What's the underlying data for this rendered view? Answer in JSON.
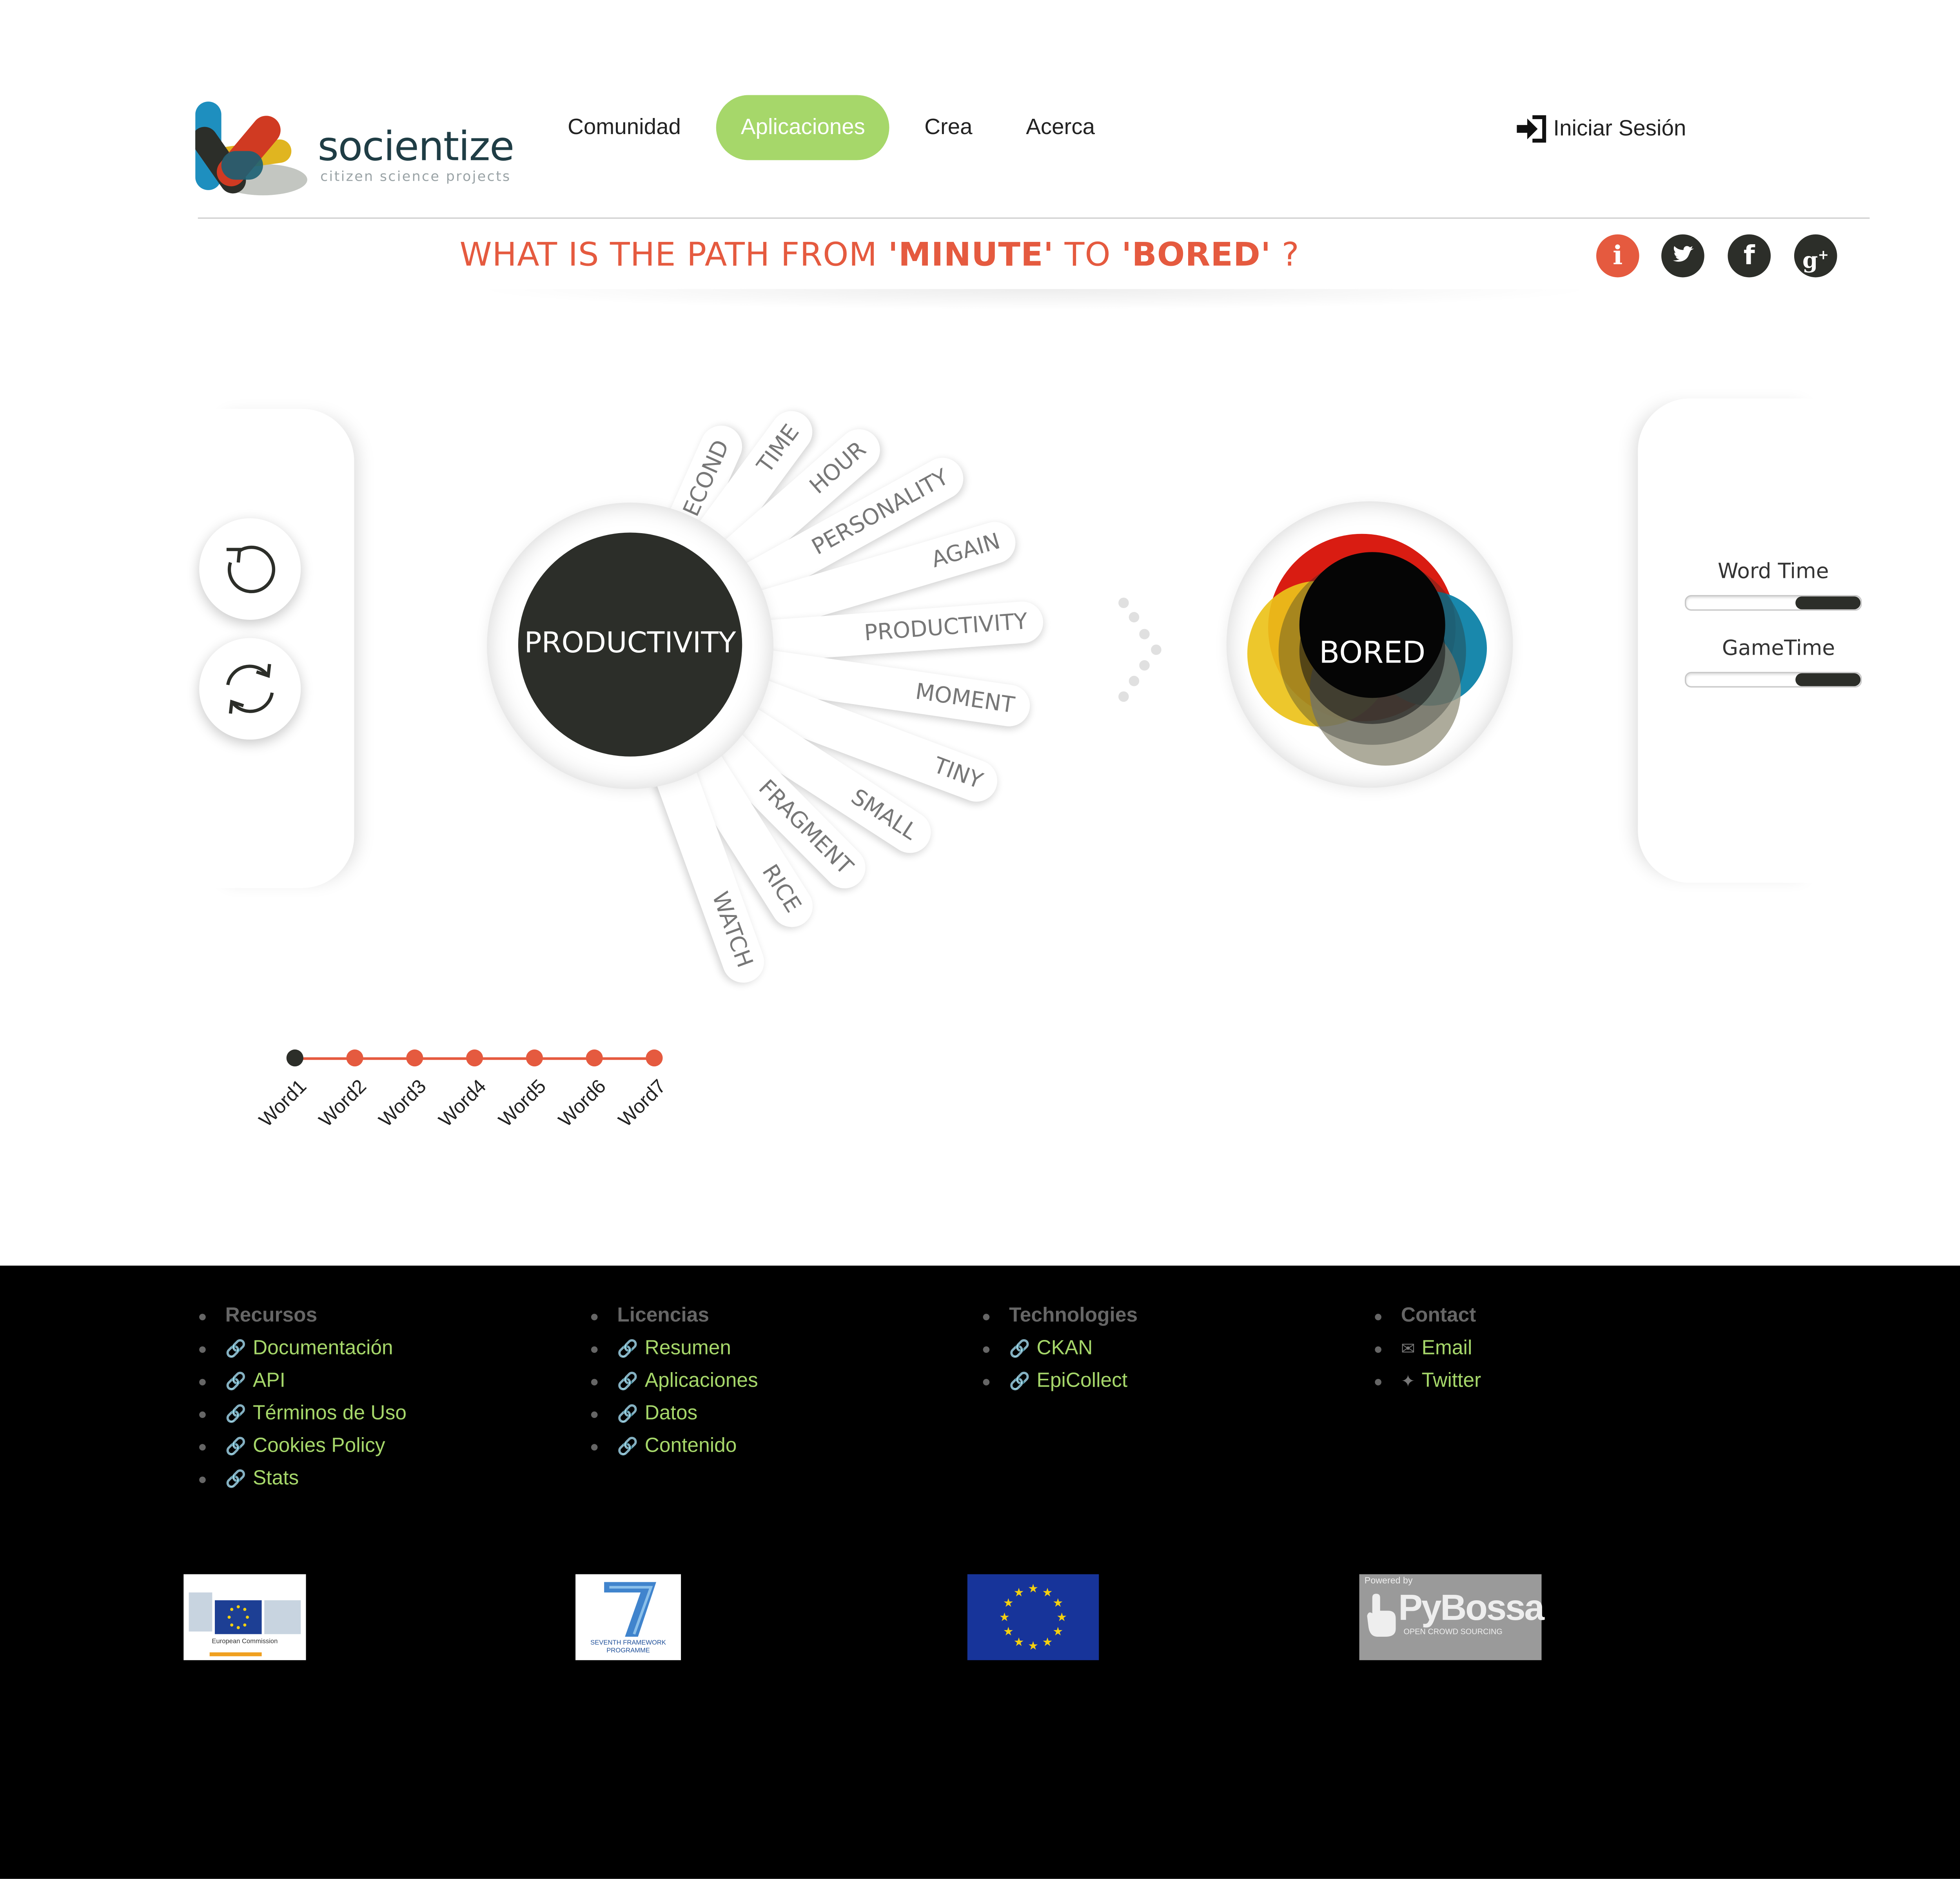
{
  "brand": {
    "name": "socientize",
    "tagline": "citizen science projects"
  },
  "nav": {
    "items": [
      {
        "label": "Comunidad",
        "active": false
      },
      {
        "label": "Aplicaciones",
        "active": true
      },
      {
        "label": "Crea",
        "active": false
      },
      {
        "label": "Acerca",
        "active": false
      }
    ],
    "login_label": "Iniciar Sesión"
  },
  "question": {
    "prefix": "WHAT IS THE PATH FROM ",
    "from_word": "'MINUTE'",
    "middle": " TO ",
    "to_word": "'BORED'",
    "suffix": " ?"
  },
  "social_icons": [
    "info-icon",
    "twitter-icon",
    "facebook-icon",
    "google-plus-icon"
  ],
  "controls": {
    "left": [
      "undo-icon",
      "restart-icon"
    ]
  },
  "game": {
    "current_word": "PRODUCTIVITY",
    "target_word": "BORED",
    "options": [
      "SECOND",
      "TIME",
      "HOUR",
      "PERSONALITY",
      "AGAIN",
      "PRODUCTIVITY",
      "MOMENT",
      "TINY",
      "SMALL",
      "FRAGMENT",
      "RICE",
      "WATCH"
    ]
  },
  "timers": [
    {
      "label": "Word Time",
      "level": 0.37
    },
    {
      "label": "GameTime",
      "level": 0.37
    }
  ],
  "path": {
    "words": [
      "Word1",
      "Word2",
      "Word3",
      "Word4",
      "Word5",
      "Word6",
      "Word7"
    ],
    "current_index": 0
  },
  "footer": {
    "columns": [
      {
        "heading": "Recursos",
        "links": [
          "Documentación",
          "API",
          "Términos de Uso",
          "Cookies Policy",
          "Stats"
        ]
      },
      {
        "heading": "Licencias",
        "links": [
          "Resumen",
          "Aplicaciones",
          "Datos",
          "Contenido"
        ]
      },
      {
        "heading": "Technologies",
        "links": [
          "CKAN",
          "EpiCollect"
        ]
      },
      {
        "heading": "Contact",
        "links": [
          "Email",
          "Twitter"
        ]
      }
    ],
    "badges": {
      "ec": {
        "caption": "European Commission"
      },
      "fp7": {
        "caption": "SEVENTH FRAMEWORK PROGRAMME"
      },
      "eu_flag": {},
      "pybossa": {
        "top": "Powered by",
        "name": "PyBossa",
        "sub": "OPEN CROWD SOURCING"
      }
    }
  },
  "colors": {
    "accent_green": "#a6d76a",
    "accent_red": "#e55a3f",
    "dark": "#2c2e29"
  }
}
